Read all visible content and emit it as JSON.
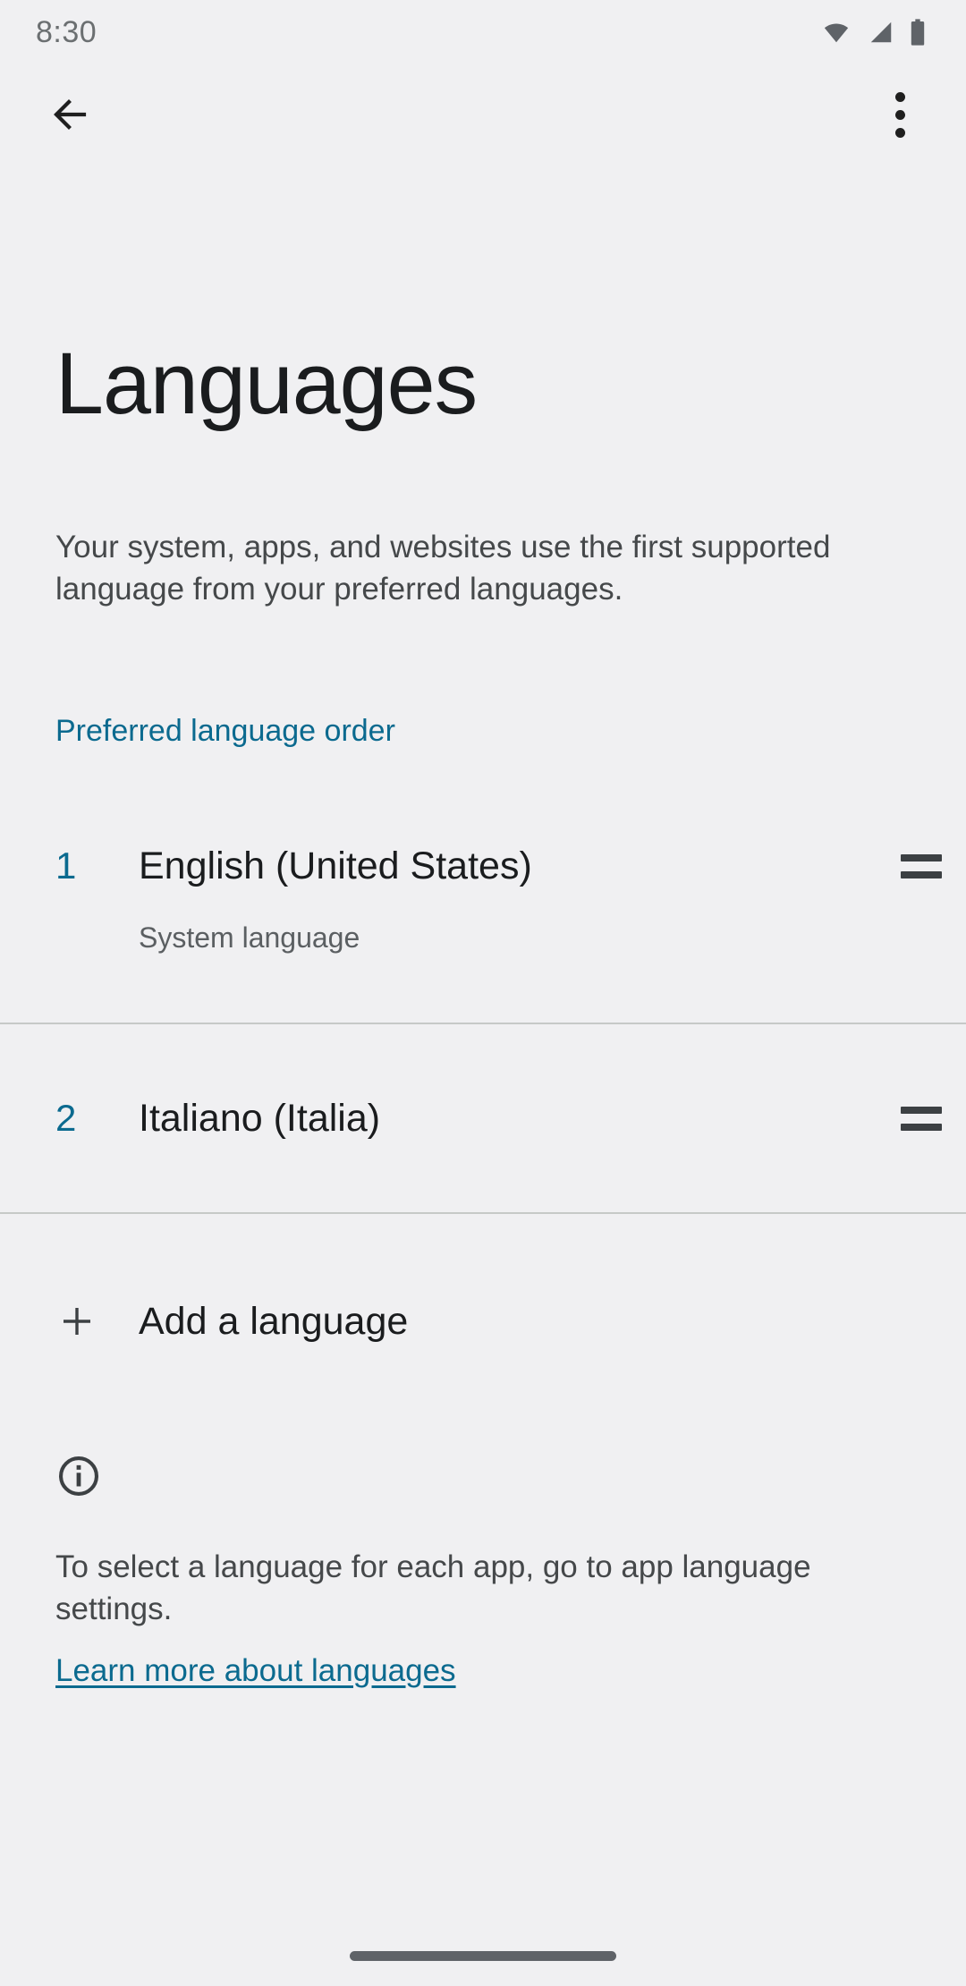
{
  "status_bar": {
    "time": "8:30",
    "icons": [
      "wifi-icon",
      "cell-signal-icon",
      "battery-icon"
    ]
  },
  "app_bar": {
    "back_icon": "back-arrow-icon",
    "overflow_icon": "more-vertical-icon"
  },
  "page": {
    "title": "Languages",
    "description": "Your system, apps, and websites use the first supported language from your preferred languages."
  },
  "section": {
    "label": "Preferred language order"
  },
  "languages": [
    {
      "number": "1",
      "name": "English (United States)",
      "subtitle": "System language",
      "drag_handle": "drag-handle-icon"
    },
    {
      "number": "2",
      "name": "Italiano (Italia)",
      "subtitle": "",
      "drag_handle": "drag-handle-icon"
    }
  ],
  "add_language": {
    "icon": "plus-icon",
    "label": "Add a language"
  },
  "footer": {
    "icon": "info-circle-icon",
    "text": "To select a language for each app, go to app language settings.",
    "link": "Learn more about languages"
  },
  "colors": {
    "background": "#f0f0f2",
    "accent": "#0b6a8f",
    "primary_text": "#1a1c1e",
    "secondary_text": "#45484a",
    "divider": "#c6c9c7",
    "icon": "#3c4043",
    "nav_pill": "#5f6368"
  }
}
